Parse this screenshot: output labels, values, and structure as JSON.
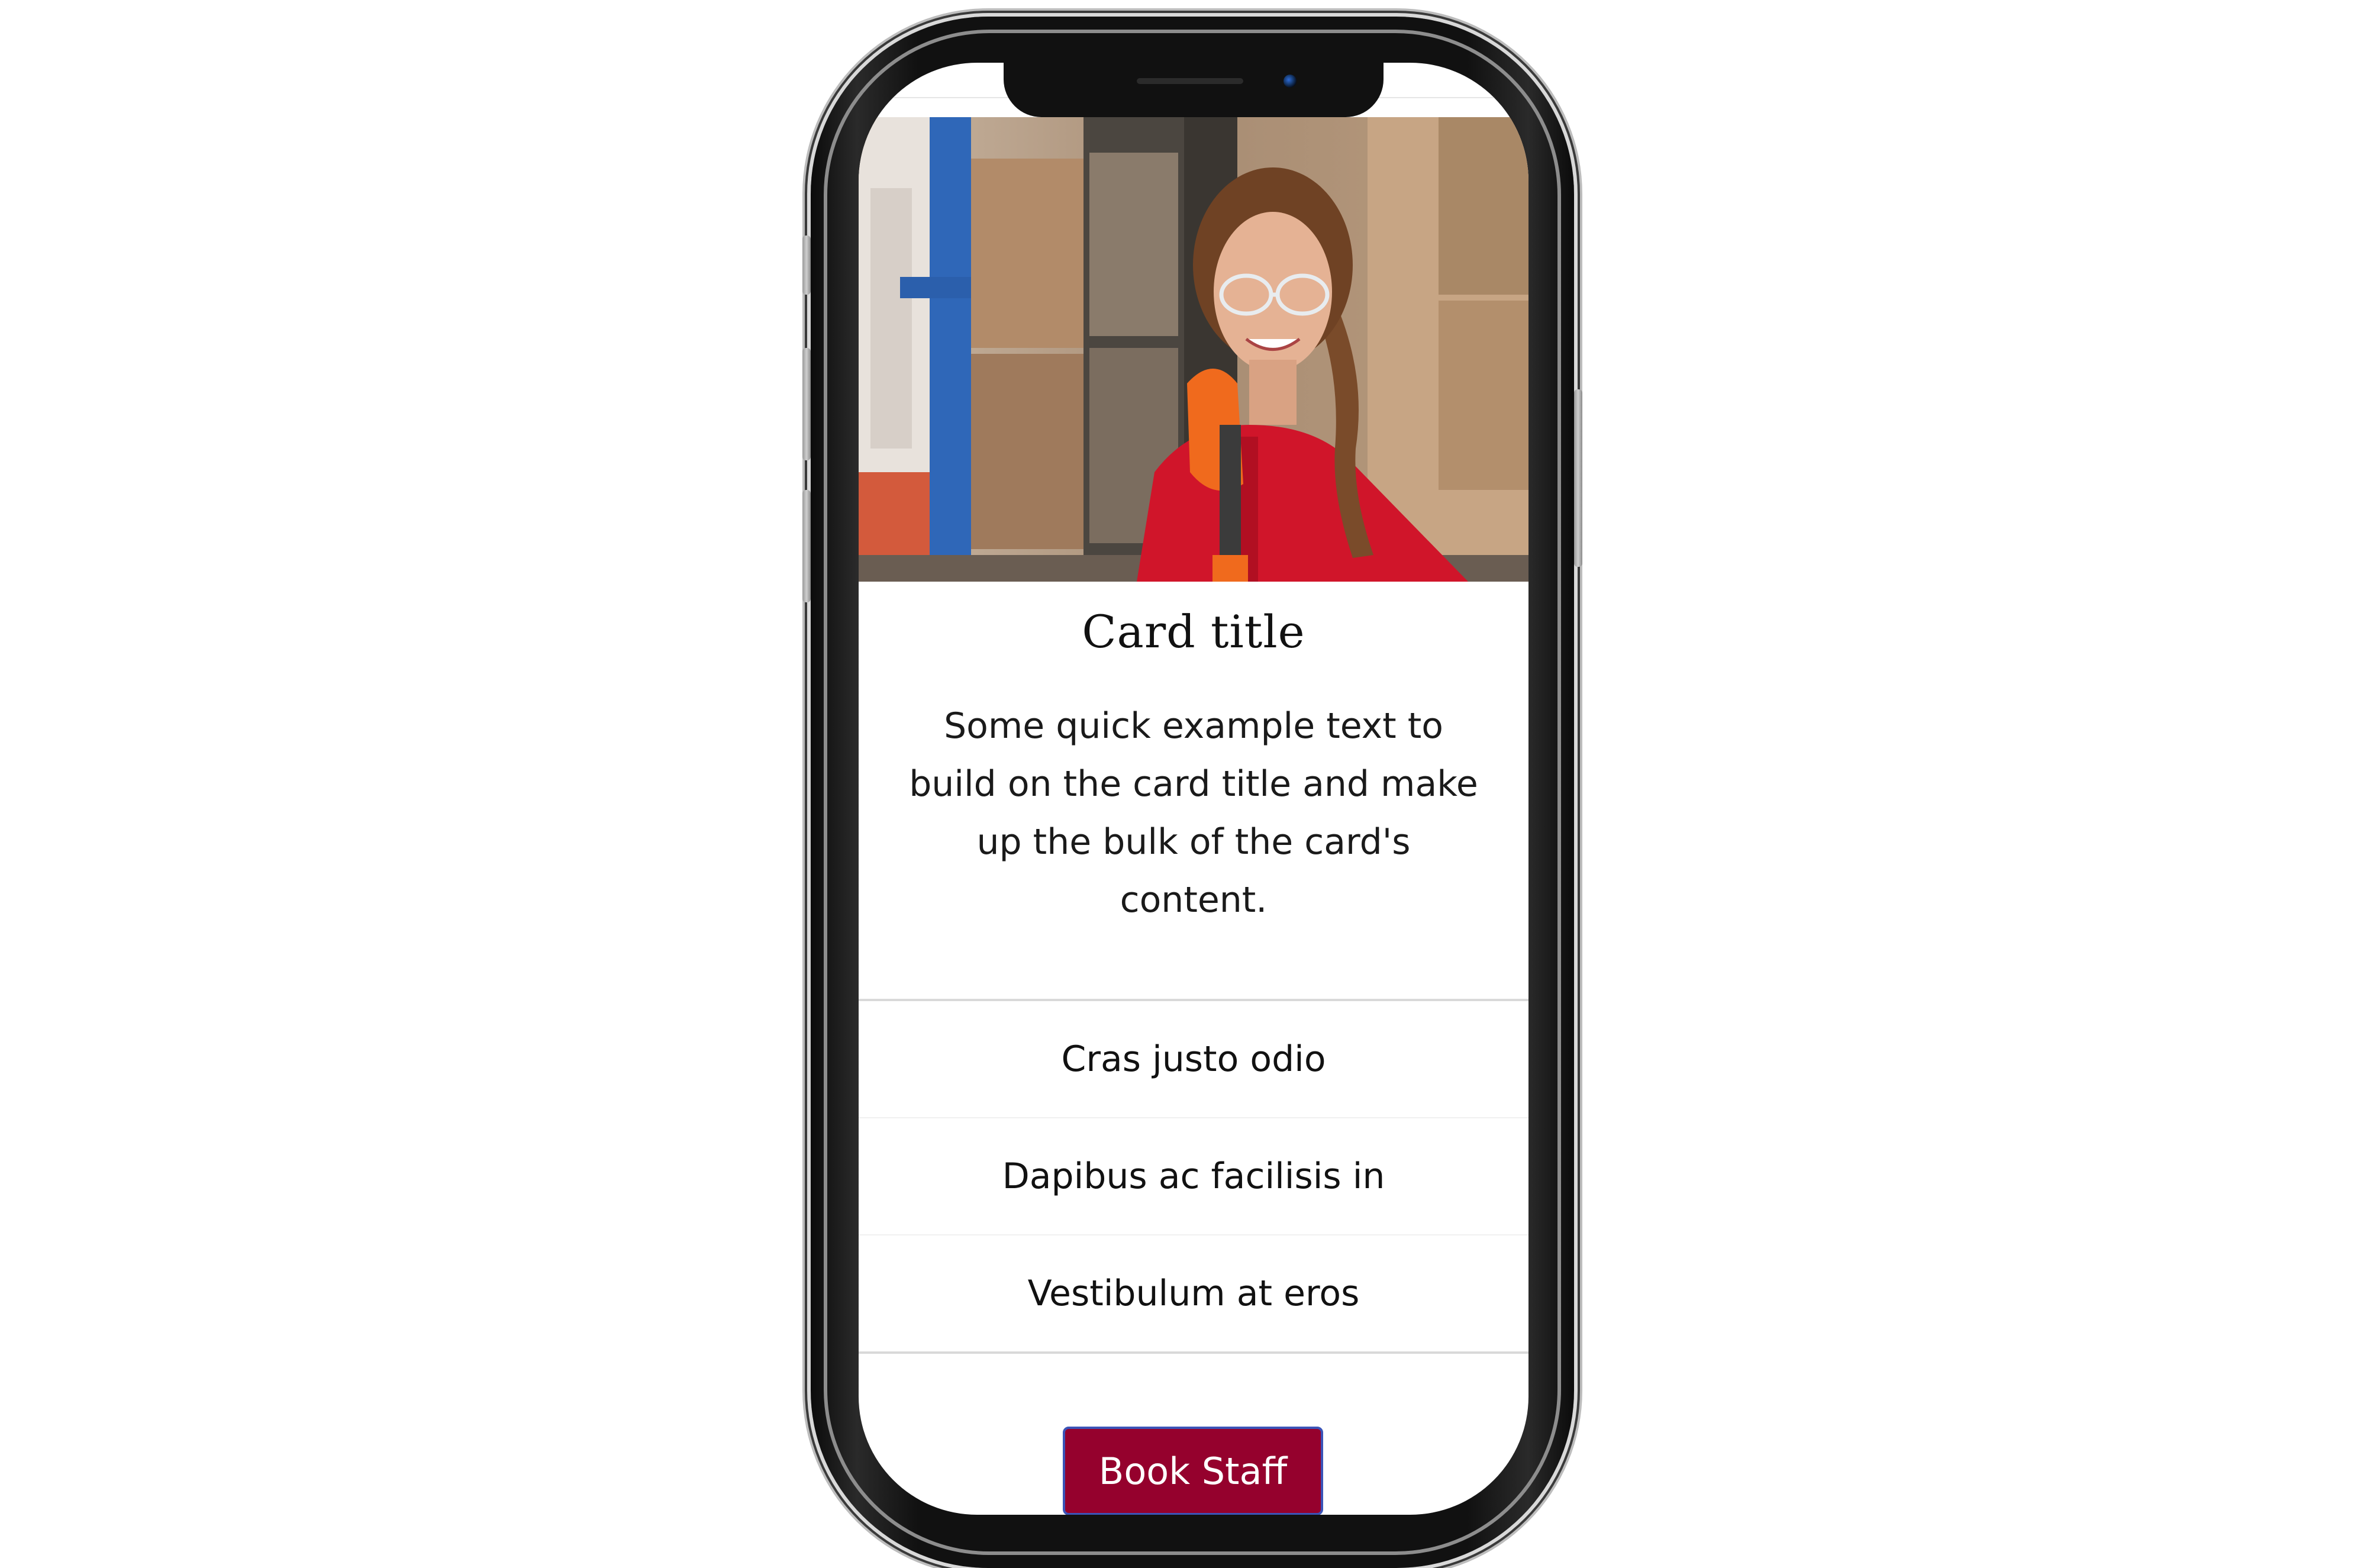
{
  "card": {
    "title": "Card title",
    "text": "Some quick example text to build on the card title and make up the bulk of the card's content."
  },
  "list_items": [
    "Cras justo odio",
    "Dapibus ac facilisis in",
    "Vestibulum at eros"
  ],
  "button": {
    "label": "Book Staff"
  },
  "colors": {
    "button_background": "#95012d",
    "button_border": "#3b54b8",
    "divider": "#d9d9d9"
  }
}
